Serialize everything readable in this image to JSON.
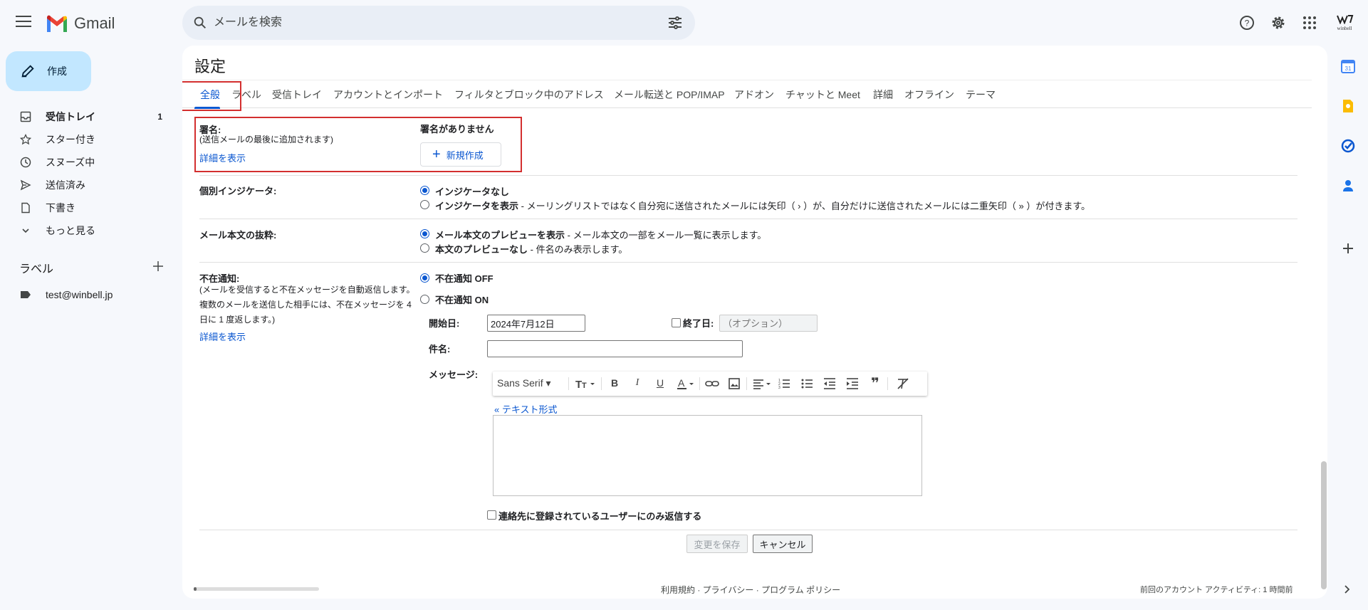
{
  "app": {
    "name": "Gmail"
  },
  "search": {
    "placeholder": "メールを検索"
  },
  "header": {
    "help_icon": "help-icon",
    "settings_icon": "gear-icon",
    "apps_icon": "apps-grid-icon",
    "brand": "winbell"
  },
  "compose": {
    "label": "作成"
  },
  "nav": {
    "items": [
      {
        "label": "受信トレイ",
        "count": "1",
        "icon": "inbox-icon",
        "bold": true
      },
      {
        "label": "スター付き",
        "icon": "star-icon"
      },
      {
        "label": "スヌーズ中",
        "icon": "clock-icon"
      },
      {
        "label": "送信済み",
        "icon": "send-icon"
      },
      {
        "label": "下書き",
        "icon": "draft-icon"
      },
      {
        "label": "もっと見る",
        "icon": "chevron-down-icon"
      }
    ]
  },
  "labels": {
    "heading": "ラベル",
    "items": [
      {
        "label": "test@winbell.jp"
      }
    ]
  },
  "settings": {
    "title": "設定",
    "tabs": [
      "全般",
      "ラベル",
      "受信トレイ",
      "アカウントとインポート",
      "フィルタとブロック中のアドレス",
      "メール転送と POP/IMAP",
      "アドオン",
      "チャットと Meet",
      "詳細",
      "オフライン",
      "テーマ"
    ],
    "signature": {
      "label": "署名:",
      "sub": "(送信メールの最後に追加されます)",
      "link": "詳細を表示",
      "none": "署名がありません",
      "new_button": "新規作成"
    },
    "indicators": {
      "label": "個別インジケータ:",
      "opt1": "インジケータなし",
      "opt2_bold": "インジケータを表示",
      "opt2_rest": " - メーリングリストではなく自分宛に送信されたメールには矢印（ › ）が、自分だけに送信されたメールには二重矢印（ » ）が付きます。"
    },
    "snippets": {
      "label": "メール本文の抜粋:",
      "opt1_bold": "メール本文のプレビューを表示",
      "opt1_rest": " - メール本文の一部をメール一覧に表示します。",
      "opt2_bold": "本文のプレビューなし",
      "opt2_rest": " - 件名のみ表示します。"
    },
    "vacation": {
      "label": "不在通知:",
      "sub1": "(メールを受信すると不在メッセージを自動返信します。",
      "sub2": "複数のメールを送信した相手には、不在メッセージを 4",
      "sub3": "日に 1 度返します。)",
      "link": "詳細を表示",
      "off": "不在通知 OFF",
      "on": "不在通知 ON",
      "start_label": "開始日:",
      "start_value": "2024年7月12日",
      "end_label": "終了日:",
      "end_placeholder": "（オプション）",
      "subject_label": "件名:",
      "message_label": "メッセージ:",
      "font": "Sans Serif",
      "plain_text_link": "« テキスト形式",
      "contacts_only": "連絡先に登録されているユーザーにのみ返信する"
    },
    "buttons": {
      "save": "変更を保存",
      "cancel": "キャンセル"
    }
  },
  "footer": {
    "links": "利用規約 · プライバシー · プログラム ポリシー",
    "activity": "前回のアカウント アクティビティ: 1 時間前"
  }
}
